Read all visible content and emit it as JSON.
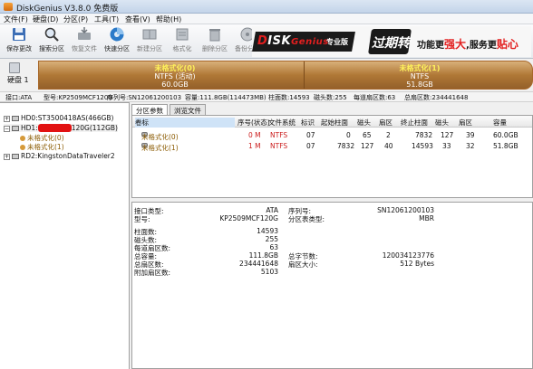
{
  "window": {
    "title": "DiskGenius V3.8.0 免费版"
  },
  "menu": [
    "文件(F)",
    "硬盘(D)",
    "分区(P)",
    "工具(T)",
    "查看(V)",
    "帮助(H)"
  ],
  "toolbar": [
    {
      "label": "保存更改",
      "icon": "save-icon",
      "dim": false
    },
    {
      "label": "搜索分区",
      "icon": "search-icon",
      "dim": false
    },
    {
      "label": "恢复文件",
      "icon": "recover-icon",
      "dim": true
    },
    {
      "label": "快速分区",
      "icon": "quick-partition-icon",
      "dim": false
    },
    {
      "label": "新建分区",
      "icon": "new-partition-icon",
      "dim": true
    },
    {
      "label": "格式化",
      "icon": "format-icon",
      "dim": true
    },
    {
      "label": "删除分区",
      "icon": "delete-icon",
      "dim": true
    },
    {
      "label": "备份分区",
      "icon": "backup-icon",
      "dim": true
    }
  ],
  "banner": {
    "brand_d": "D",
    "brand_rest": "ISK",
    "brand_g": "Genius",
    "brand_sub": "专业版",
    "slogan": "过期转",
    "ad_pre": "功能更",
    "ad_strong": "强大",
    "ad_mid": ",服务更",
    "ad_end": "贴心"
  },
  "disk_label": "硬盘 1",
  "partitions": [
    {
      "name": "未格式化(0)",
      "fs": "NTFS (活动)",
      "size": "60.0GB"
    },
    {
      "name": "未格式化(1)",
      "fs": "NTFS",
      "size": "51.8GB"
    }
  ],
  "info": {
    "iface": "接口:ATA",
    "model": "型号:KP2509MCF120G",
    "serial": "序列号:SN12061200103",
    "capacity": "容量:111.8GB(114473MB)",
    "cyl": "柱面数:14593",
    "heads": "磁头数:255",
    "spt": "每道扇区数:63",
    "sectors": "总扇区数:234441648"
  },
  "tree": {
    "hd0": "HD0:ST3500418AS(466GB)",
    "hd1_prefix": "HD1:",
    "hd1_redacted": "KP2509M",
    "hd1_suffix": "120G(112GB)",
    "p0": "未格式化(0)",
    "p1": "未格式化(1)",
    "rd2": "RD2:KingstonDataTraveler2"
  },
  "tabs": [
    "分区参数",
    "浏览文件"
  ],
  "grid": {
    "headers": [
      "卷标",
      "序号(状态)",
      "文件系统",
      "标识",
      "起始柱面",
      "磁头",
      "扇区",
      "终止柱面",
      "磁头",
      "扇区",
      "容量"
    ],
    "rows": [
      [
        "未格式化(0)",
        "0 M",
        "NTFS",
        "07",
        "0",
        "65",
        "2",
        "7832",
        "127",
        "39",
        "60.0GB"
      ],
      [
        "未格式化(1)",
        "1 M",
        "NTFS",
        "07",
        "7832",
        "127",
        "40",
        "14593",
        "33",
        "32",
        "51.8GB"
      ]
    ]
  },
  "details": {
    "iface_label": "接口类型:",
    "iface": "ATA",
    "model_label": "型号:",
    "model": "KP2509MCF120G",
    "serial_label": "序列号:",
    "serial": "SN12061200103",
    "ptype_label": "分区表类型:",
    "ptype": "MBR",
    "cyl_label": "柱面数:",
    "cyl": "14593",
    "heads_label": "磁头数:",
    "heads": "255",
    "spt_label": "每道扇区数:",
    "spt": "63",
    "cap_label": "总容量:",
    "cap": "111.8GB",
    "bytes_label": "总字节数:",
    "bytes": "120034123776",
    "sectors_label": "总扇区数:",
    "sectors": "234441648",
    "ssize_label": "扇区大小:",
    "ssize": "512 Bytes",
    "extra_label": "附加扇区数:",
    "extra": "5103"
  }
}
